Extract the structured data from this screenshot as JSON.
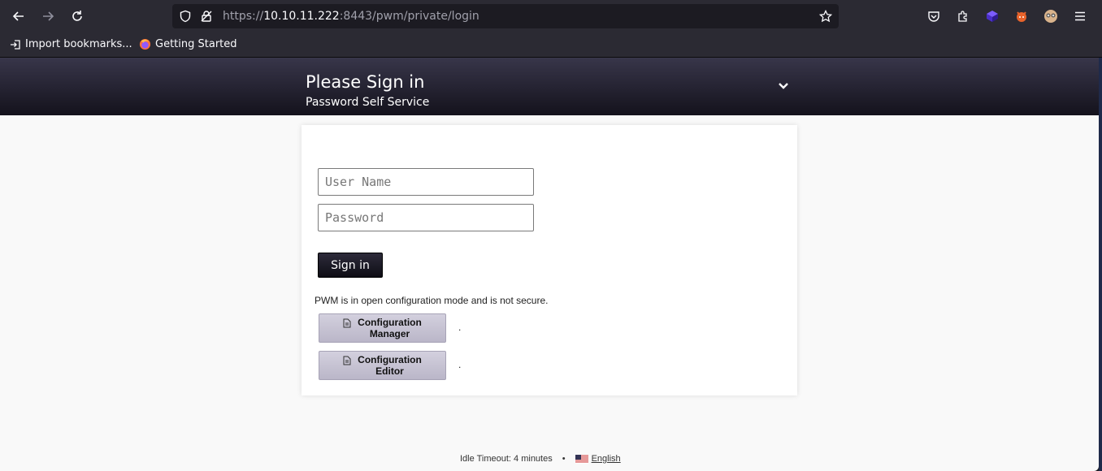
{
  "browser": {
    "url_scheme": "https://",
    "url_host": "10.10.11.222",
    "url_rest": ":8443/pwm/private/login",
    "bookmarks": [
      {
        "label": "Import bookmarks..."
      },
      {
        "label": "Getting Started"
      }
    ]
  },
  "header": {
    "title": "Please Sign in",
    "subtitle": "Password Self Service"
  },
  "login": {
    "username_placeholder": "User Name",
    "password_placeholder": "Password",
    "signin_label": "Sign in"
  },
  "config": {
    "notice": "PWM is in open configuration mode and is not secure.",
    "manager_line1": "Configuration",
    "manager_line2": "Manager",
    "editor_line1": "Configuration",
    "editor_line2": "Editor",
    "dot": "."
  },
  "footer": {
    "idle_timeout": "Idle Timeout: 4 minutes",
    "separator": "•",
    "language": "English"
  },
  "colors": {
    "header_bg": "#14121c",
    "signin_bg": "#14121c",
    "config_btn_bg": "#c6c2d3",
    "browser_bg": "#2b2a33"
  }
}
